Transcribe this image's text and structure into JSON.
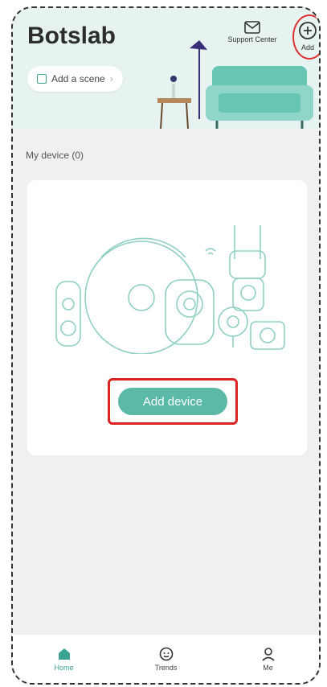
{
  "header": {
    "app_title": "Botslab",
    "scene_button": "Add a scene",
    "support_label": "Support Center",
    "add_label": "Add"
  },
  "devices": {
    "section_label": "My device (0)",
    "add_device_button": "Add device"
  },
  "tabs": [
    {
      "label": "Home",
      "icon": "home-icon",
      "active": true
    },
    {
      "label": "Trends",
      "icon": "trends-icon",
      "active": false
    },
    {
      "label": "Me",
      "icon": "user-icon",
      "active": false
    }
  ],
  "colors": {
    "accent": "#5ab9a7",
    "highlight_box": "#d22222"
  }
}
